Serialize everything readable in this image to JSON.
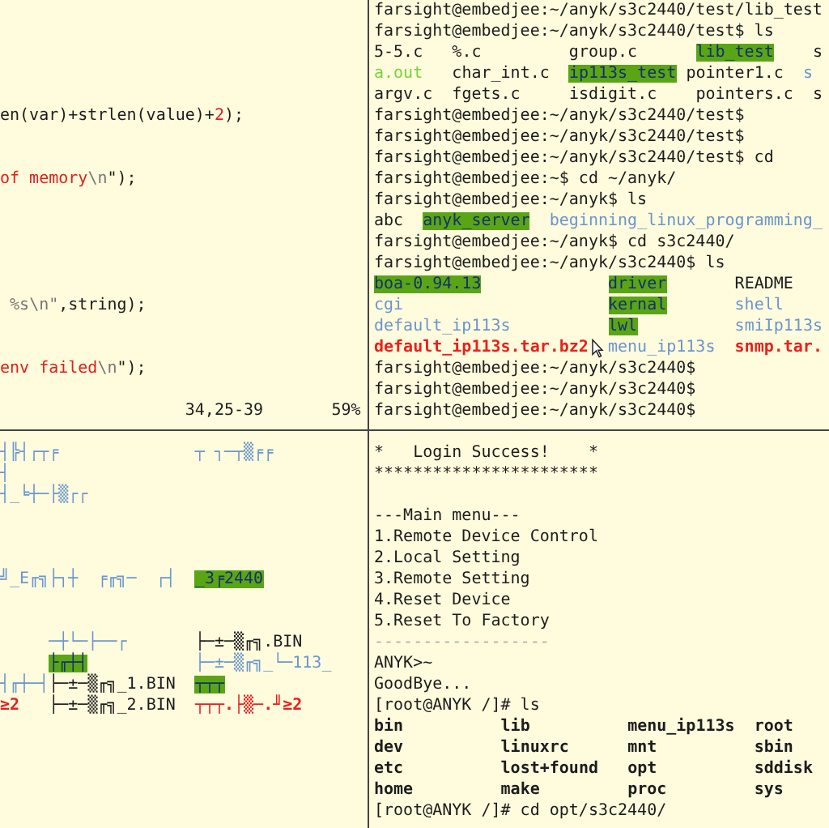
{
  "panes": [
    {
      "lines": [
        {
          "kind": "blank"
        },
        {
          "kind": "blank"
        },
        {
          "kind": "blank"
        },
        {
          "kind": "blank"
        },
        {
          "kind": "blank"
        },
        {
          "segments": [
            {
              "text": "en(var)+strlen(value)+",
              "kind": "code"
            },
            {
              "text": "2",
              "kind": "number"
            },
            {
              "text": ");",
              "kind": "code"
            }
          ]
        },
        {
          "kind": "blank"
        },
        {
          "kind": "blank"
        },
        {
          "segments": [
            {
              "text": "of memory",
              "kind": "string"
            },
            {
              "text": "\\n",
              "kind": "special"
            },
            {
              "text": "\");",
              "kind": "code"
            }
          ]
        },
        {
          "kind": "blank"
        },
        {
          "kind": "blank"
        },
        {
          "kind": "blank"
        },
        {
          "kind": "blank"
        },
        {
          "kind": "blank"
        },
        {
          "segments": [
            {
              "text": " %s\\n\"",
              "kind": "special"
            },
            {
              "text": ",string);",
              "kind": "code"
            }
          ]
        },
        {
          "kind": "blank"
        },
        {
          "kind": "blank"
        },
        {
          "segments": [
            {
              "text": "env failed",
              "kind": "string"
            },
            {
              "text": "\\n",
              "kind": "special"
            },
            {
              "text": "\");",
              "kind": "code"
            }
          ]
        },
        {
          "kind": "blank"
        },
        {
          "segments": [
            {
              "text": "                   34,25-39",
              "kind": "plain"
            },
            {
              "text": "       59%",
              "kind": "plain"
            }
          ]
        }
      ]
    },
    {
      "lines": [
        {
          "segments": [
            {
              "text": "┤╠┤┌┬╒",
              "kind": "dir"
            },
            {
              "text": "              ┬ ┐─┬▒╒╒",
              "kind": "dir"
            }
          ]
        },
        {
          "segments": [
            {
              "text": "┤",
              "kind": "dir"
            }
          ]
        },
        {
          "segments": [
            {
              "text": "┤_╘┼─├▒┌┌",
              "kind": "dir"
            }
          ]
        },
        {
          "kind": "blank"
        },
        {
          "kind": "blank"
        },
        {
          "kind": "blank"
        },
        {
          "segments": [
            {
              "text": "╝_E╓╗├┐┼  ╒╓╗─  ┌┤",
              "kind": "dir"
            },
            {
              "text": "  _3╒2440",
              "kind": "highlight"
            }
          ]
        },
        {
          "kind": "blank"
        },
        {
          "kind": "blank"
        },
        {
          "segments": [
            {
              "text": "     ─┼└─├──┌",
              "kind": "dir"
            },
            {
              "text": "       ├─±─▒╓╗.BIN",
              "kind": "plain"
            }
          ]
        },
        {
          "segments": [
            {
              "text": "     ├╓┼┤",
              "kind": "highlight"
            },
            {
              "text": "           ├─±─▒╓╗_└─113_",
              "kind": "dir"
            }
          ]
        },
        {
          "segments": [
            {
              "text": "┤╓┼─┤",
              "kind": "dir"
            },
            {
              "text": "├─±─▒╓╗_1.BIN",
              "kind": "plain"
            },
            {
              "text": "  ┬┬┬",
              "kind": "highlight"
            }
          ]
        },
        {
          "segments": [
            {
              "text": "≥2",
              "kind": "archive"
            },
            {
              "text": "   ├─±─▒╓╗_2.BIN",
              "kind": "plain"
            },
            {
              "text": "  ┬┬┬.├▒─.╜≥2",
              "kind": "archive"
            }
          ]
        }
      ]
    },
    {
      "lines": [
        {
          "segments": [
            {
              "text": "farsight@embedjee:~/anyk/s3c2440/test/lib_test",
              "kind": "plain"
            }
          ]
        },
        {
          "segments": [
            {
              "text": "farsight@embedjee:~/anyk/s3c2440/test$ ls",
              "kind": "plain"
            }
          ]
        },
        {
          "segments": [
            {
              "text": "5-5.c",
              "kind": "plain"
            },
            {
              "text": "   %.c",
              "kind": "plain"
            },
            {
              "text": "         group.c",
              "kind": "plain"
            },
            {
              "text": "      lib_test",
              "kind": "highlight"
            },
            {
              "text": "    s",
              "kind": "plain"
            }
          ]
        },
        {
          "segments": [
            {
              "text": "a.out",
              "kind": "exe"
            },
            {
              "text": "   char_int.c",
              "kind": "plain"
            },
            {
              "text": "  ip113s_test",
              "kind": "highlight"
            },
            {
              "text": " pointer1.c",
              "kind": "plain"
            },
            {
              "text": "  s",
              "kind": "dir"
            }
          ]
        },
        {
          "segments": [
            {
              "text": "argv.c",
              "kind": "plain"
            },
            {
              "text": "  fgets.c",
              "kind": "plain"
            },
            {
              "text": "     isdigit.c",
              "kind": "plain"
            },
            {
              "text": "    pointers.c",
              "kind": "plain"
            },
            {
              "text": "  s",
              "kind": "plain"
            }
          ]
        },
        {
          "segments": [
            {
              "text": "farsight@embedjee:~/anyk/s3c2440/test$",
              "kind": "plain"
            }
          ]
        },
        {
          "segments": [
            {
              "text": "farsight@embedjee:~/anyk/s3c2440/test$",
              "kind": "plain"
            }
          ]
        },
        {
          "segments": [
            {
              "text": "farsight@embedjee:~/anyk/s3c2440/test$ cd",
              "kind": "plain"
            }
          ]
        },
        {
          "segments": [
            {
              "text": "farsight@embedjee:~$ cd ~/anyk/",
              "kind": "plain"
            }
          ]
        },
        {
          "segments": [
            {
              "text": "farsight@embedjee:~/anyk$ ls",
              "kind": "plain"
            }
          ]
        },
        {
          "segments": [
            {
              "text": "abc",
              "kind": "plain"
            },
            {
              "text": "  anyk_server",
              "kind": "highlight"
            },
            {
              "text": "  beginning_linux_programming_",
              "kind": "dir"
            }
          ]
        },
        {
          "segments": [
            {
              "text": "farsight@embedjee:~/anyk$ cd s3c2440/",
              "kind": "plain"
            }
          ]
        },
        {
          "segments": [
            {
              "text": "farsight@embedjee:~/anyk/s3c2440$ ls",
              "kind": "plain"
            }
          ]
        },
        {
          "segments": [
            {
              "text": "boa-0.94.13",
              "kind": "highlight"
            },
            {
              "text": "             driver",
              "kind": "highlight"
            },
            {
              "text": "       README",
              "kind": "plain"
            }
          ]
        },
        {
          "segments": [
            {
              "text": "cgi",
              "kind": "dir"
            },
            {
              "text": "                     kernal",
              "kind": "highlight"
            },
            {
              "text": "       shell",
              "kind": "dir"
            }
          ]
        },
        {
          "segments": [
            {
              "text": "default_ip113s",
              "kind": "dir"
            },
            {
              "text": "          lwl",
              "kind": "highlight"
            },
            {
              "text": "          smiIp113s",
              "kind": "dir"
            }
          ]
        },
        {
          "segments": [
            {
              "text": "default_ip113s.tar.bz2",
              "kind": "archive"
            },
            {
              "text": "  menu_ip113s",
              "kind": "dir"
            },
            {
              "text": "  snmp.tar.",
              "kind": "archive"
            }
          ]
        },
        {
          "segments": [
            {
              "text": "farsight@embedjee:~/anyk/s3c2440$",
              "kind": "plain"
            }
          ]
        },
        {
          "segments": [
            {
              "text": "farsight@embedjee:~/anyk/s3c2440$",
              "kind": "plain"
            }
          ]
        },
        {
          "segments": [
            {
              "text": "farsight@embedjee:~/anyk/s3c2440$",
              "kind": "plain"
            }
          ]
        }
      ]
    },
    {
      "lines": [
        {
          "segments": [
            {
              "text": "*   Login Success!    *",
              "kind": "plain"
            }
          ]
        },
        {
          "segments": [
            {
              "text": "***********************",
              "kind": "plain"
            }
          ]
        },
        {
          "kind": "blank"
        },
        {
          "segments": [
            {
              "text": "---Main menu---",
              "kind": "plain"
            }
          ]
        },
        {
          "segments": [
            {
              "text": "1.Remote Device Control",
              "kind": "plain"
            }
          ]
        },
        {
          "segments": [
            {
              "text": "2.Local Setting",
              "kind": "plain"
            }
          ]
        },
        {
          "segments": [
            {
              "text": "3.Remote Setting",
              "kind": "plain"
            }
          ]
        },
        {
          "segments": [
            {
              "text": "4.Reset Device",
              "kind": "plain"
            }
          ]
        },
        {
          "segments": [
            {
              "text": "5.Reset To Factory",
              "kind": "plain"
            }
          ]
        },
        {
          "segments": [
            {
              "text": "------------------",
              "kind": "dim"
            }
          ]
        },
        {
          "segments": [
            {
              "text": "ANYK>~",
              "kind": "plain"
            }
          ]
        },
        {
          "segments": [
            {
              "text": "GoodBye...",
              "kind": "plain"
            }
          ]
        },
        {
          "segments": [
            {
              "text": "[root@ANYK /]# ls",
              "kind": "plain"
            }
          ]
        },
        {
          "segments": [
            {
              "text": "bin",
              "kind": "bold"
            },
            {
              "text": "          lib",
              "kind": "bold"
            },
            {
              "text": "          menu_ip113s",
              "kind": "bold"
            },
            {
              "text": "  root",
              "kind": "bold"
            }
          ]
        },
        {
          "segments": [
            {
              "text": "dev",
              "kind": "bold"
            },
            {
              "text": "          linuxrc",
              "kind": "bold"
            },
            {
              "text": "      mnt",
              "kind": "bold"
            },
            {
              "text": "          sbin",
              "kind": "bold"
            }
          ]
        },
        {
          "segments": [
            {
              "text": "etc",
              "kind": "bold"
            },
            {
              "text": "          lost+found",
              "kind": "bold"
            },
            {
              "text": "   opt",
              "kind": "bold"
            },
            {
              "text": "          sddisk",
              "kind": "bold"
            }
          ]
        },
        {
          "segments": [
            {
              "text": "home",
              "kind": "bold"
            },
            {
              "text": "         make",
              "kind": "bold"
            },
            {
              "text": "         proc",
              "kind": "bold"
            },
            {
              "text": "         sys",
              "kind": "bold"
            }
          ]
        },
        {
          "segments": [
            {
              "text": "[root@ANYK /]# cd opt/s3c2440/",
              "kind": "plain"
            }
          ]
        }
      ]
    }
  ]
}
